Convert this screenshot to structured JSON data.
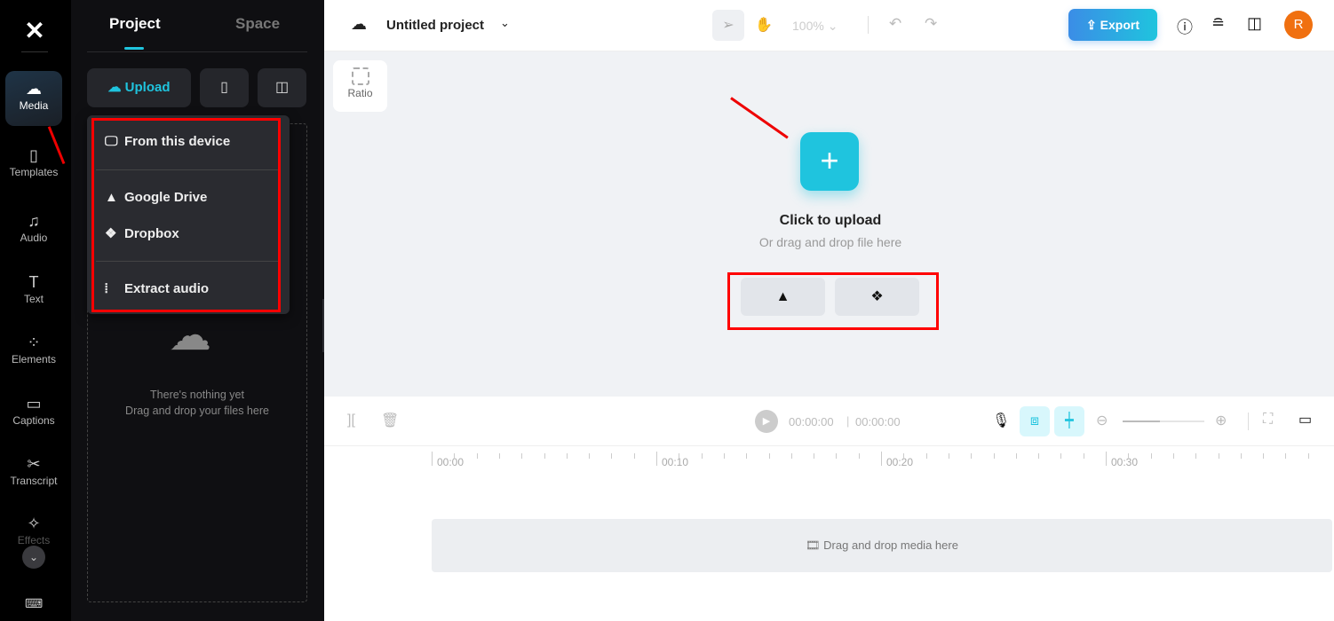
{
  "rail": {
    "items": [
      {
        "label": "Media",
        "icon": "cloud-upload-icon",
        "active": true
      },
      {
        "label": "Templates",
        "icon": "templates-icon"
      },
      {
        "label": "Audio",
        "icon": "music-icon"
      },
      {
        "label": "Text",
        "icon": "text-icon"
      },
      {
        "label": "Elements",
        "icon": "elements-icon"
      },
      {
        "label": "Captions",
        "icon": "captions-icon"
      },
      {
        "label": "Transcript",
        "icon": "transcript-icon"
      },
      {
        "label": "Effects",
        "icon": "effects-icon"
      }
    ]
  },
  "panel": {
    "tabs": [
      "Project",
      "Space"
    ],
    "upload_label": "Upload",
    "empty_title": "There's nothing yet",
    "empty_sub": "Drag and drop your files here",
    "menu": [
      "From this device",
      "Google Drive",
      "Dropbox",
      "Extract audio"
    ]
  },
  "top": {
    "project_name": "Untitled project",
    "zoom": "100%",
    "export_label": "Export",
    "avatar_initial": "R"
  },
  "canvas": {
    "ratio_label": "Ratio",
    "upload_title": "Click to upload",
    "upload_sub": "Or drag and drop file here"
  },
  "timeline": {
    "current_time": "00:00:00",
    "total_time": "00:00:00",
    "ruler": [
      "00:00",
      "00:10",
      "00:20",
      "00:30"
    ],
    "track_hint": "Drag and drop media here"
  },
  "colors": {
    "accent": "#1fc4de",
    "export_gradient": [
      "#3b8de6",
      "#1fc4de"
    ],
    "avatar": "#f07010",
    "highlight": "#ff0000"
  }
}
